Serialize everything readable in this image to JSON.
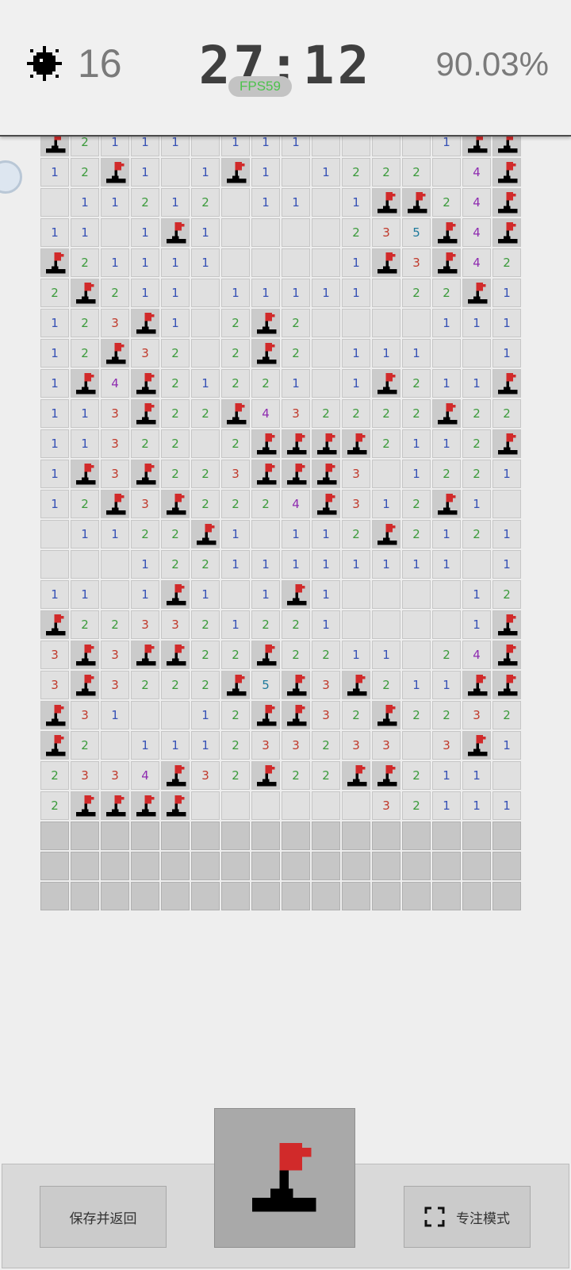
{
  "header": {
    "mines_remaining": "16",
    "timer": "27:12",
    "fps": "FPS59",
    "progress": "90.03%"
  },
  "board": {
    "rows": [
      "F2111 111    1FF3",
      "12F1 1F1 1222 4FF",
      " 11212 11 1FF24F4",
      "11 1F1    235F4F2",
      "F21111    1F3F421",
      "2F211 11111 22F1 ",
      "123F1 2F2    111 ",
      "12F32 2F2 111  11",
      "1F4F21221 1F211F",
      "113F22F432222F222",
      "11322 2FFFF2112F1",
      "1F3F223FFF3 1221",
      "12F3F2224F312F1 ",
      " 1122F1 112F2121",
      "   12211111111 1F",
      "11 1F1 1F1    122",
      "F223321221    1F2",
      "3F3FF22F2211 24F",
      "3F3222F5F3F211FF",
      "F31  12FF32F2232",
      "F2 111233233 3F1 ",
      "2334F32F22FF211 ",
      "2FFFF      32111",
      "#################",
      "#################",
      "#################"
    ],
    "number_colors": {
      "1": "#3651b5",
      "2": "#3b9a3b",
      "3": "#c0392b",
      "4": "#8e2bb0",
      "5": "#1f7a9c"
    }
  },
  "controls": {
    "save_label": "保存并返回",
    "focus_label": "专注模式"
  },
  "icons": {
    "mine": "mine-icon",
    "flag": "flag-icon",
    "focus": "focus-frame-icon"
  }
}
